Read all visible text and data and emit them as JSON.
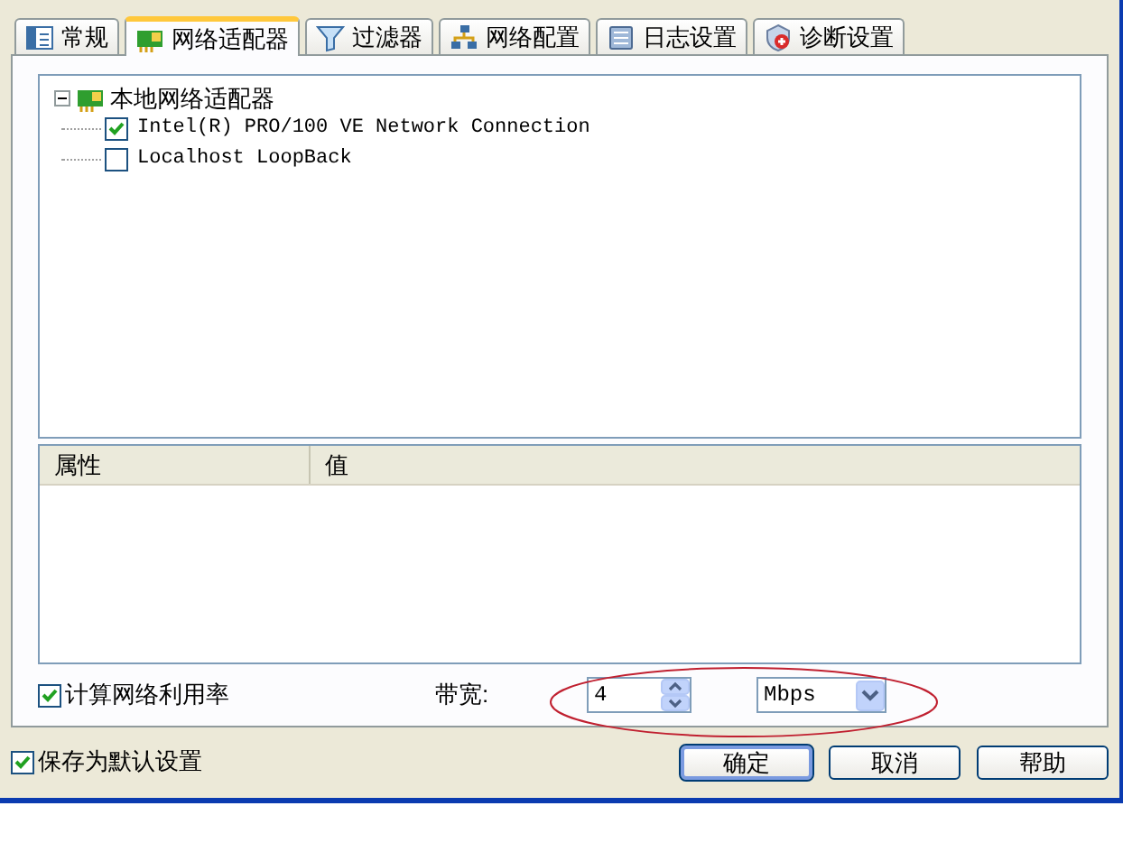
{
  "tabs": [
    {
      "label": "常规",
      "selected": false
    },
    {
      "label": "网络适配器",
      "selected": true
    },
    {
      "label": "过滤器",
      "selected": false
    },
    {
      "label": "网络配置",
      "selected": false
    },
    {
      "label": "日志设置",
      "selected": false
    },
    {
      "label": "诊断设置",
      "selected": false
    }
  ],
  "adapter_tree": {
    "label": "本地网络适配器",
    "expanded": true,
    "children": [
      {
        "label": "Intel(R) PRO/100 VE Network Connection",
        "checked": true
      },
      {
        "label": "Localhost LoopBack",
        "checked": false
      }
    ]
  },
  "properties_table": {
    "columns": [
      "属性",
      "值"
    ]
  },
  "compute_utilization": {
    "label": "计算网络利用率",
    "checked": true
  },
  "bandwidth": {
    "label": "带宽:",
    "value": "4",
    "unit": "Mbps"
  },
  "save_default": {
    "label": "保存为默认设置",
    "checked": true
  },
  "buttons": [
    {
      "label": "确定",
      "default": true
    },
    {
      "label": "取消",
      "default": false
    },
    {
      "label": "帮助",
      "default": false
    }
  ]
}
